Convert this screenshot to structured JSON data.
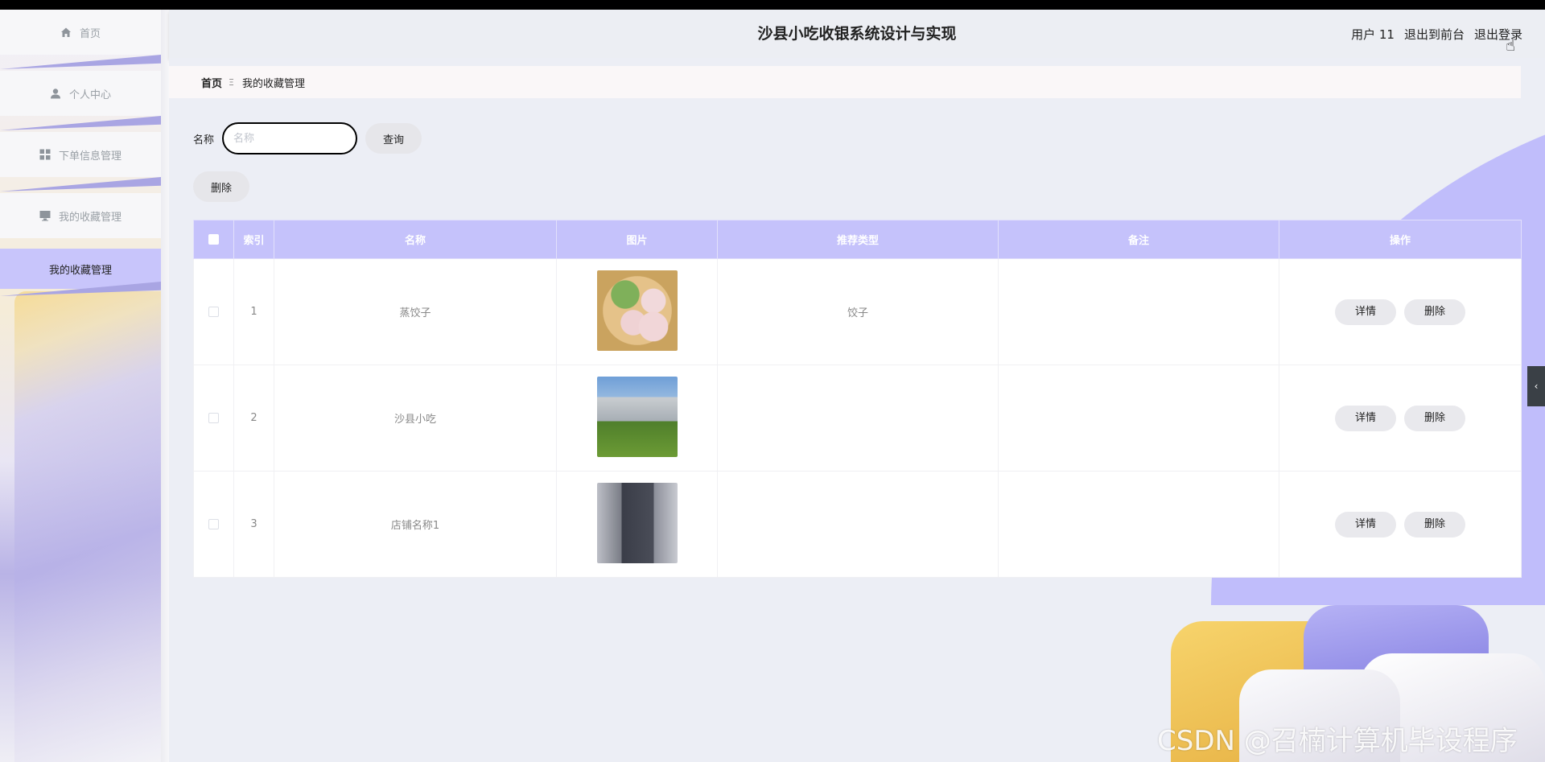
{
  "app": {
    "title": "沙县小吃收银系统设计与实现"
  },
  "header": {
    "user": "用户 11",
    "to_front": "退出到前台",
    "logout": "退出登录"
  },
  "sidebar": {
    "items": [
      {
        "label": "首页",
        "icon": "home-icon"
      },
      {
        "label": "个人中心",
        "icon": "user-icon"
      },
      {
        "label": "下单信息管理",
        "icon": "grid-icon"
      },
      {
        "label": "我的收藏管理",
        "icon": "monitor-icon"
      }
    ],
    "active_sub": "我的收藏管理"
  },
  "breadcrumb": {
    "home": "首页",
    "separator": "Ξ",
    "current": "我的收藏管理"
  },
  "search": {
    "label": "名称",
    "placeholder": "名称",
    "value": "",
    "query_button": "查询"
  },
  "toolbar": {
    "delete_button": "删除"
  },
  "table": {
    "columns": [
      "索引",
      "名称",
      "图片",
      "推荐类型",
      "备注",
      "操作"
    ],
    "rows": [
      {
        "index": "1",
        "name": "蒸饺子",
        "image": "dumplings-image",
        "type": "饺子",
        "remark": ""
      },
      {
        "index": "2",
        "name": "沙县小吃",
        "image": "building-image",
        "type": "",
        "remark": ""
      },
      {
        "index": "3",
        "name": "店铺名称1",
        "image": "storefront-image",
        "type": "",
        "remark": ""
      }
    ],
    "detail_button": "详情",
    "delete_button": "删除"
  },
  "watermark": "CSDN @召楠计算机毕设程序",
  "colors": {
    "accent": "#c5c2fb",
    "sidebar_active": "#c8c5fb",
    "header_bg": "#eceef3"
  }
}
